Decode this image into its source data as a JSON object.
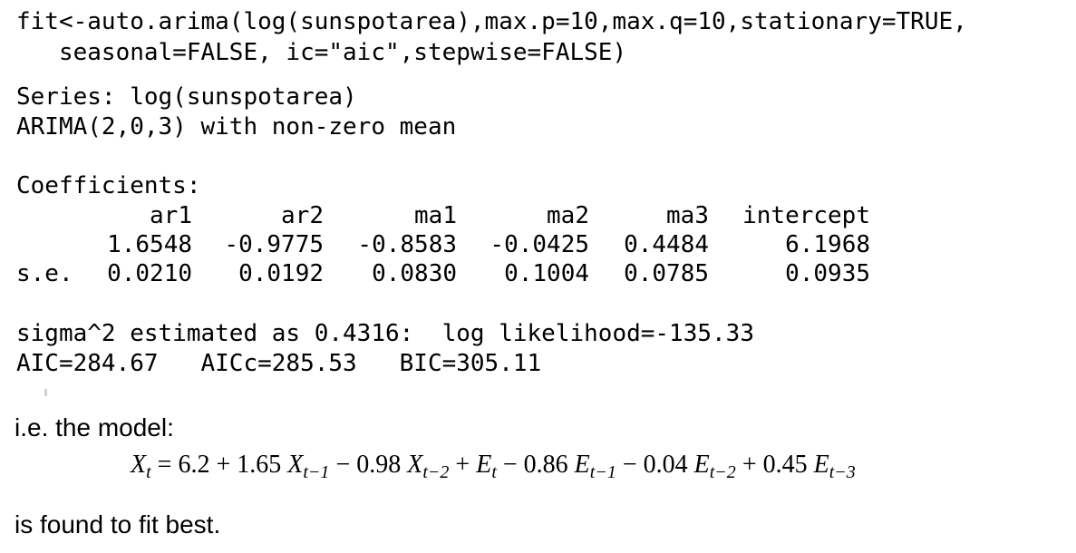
{
  "code": {
    "line1": "fit<-auto.arima(log(sunspotarea),max.p=10,max.q=10,stationary=TRUE,",
    "line2": "   seasonal=FALSE, ic=\"aic\",stepwise=FALSE)"
  },
  "output": {
    "series": "Series: log(sunspotarea)",
    "model": "ARIMA(2,0,3) with non-zero mean",
    "coef_heading": "Coefficients:",
    "se_label": "s.e.",
    "coefficients": [
      {
        "name": "ar1",
        "estimate": "1.6548",
        "se": "0.0210"
      },
      {
        "name": "ar2",
        "estimate": "-0.9775",
        "se": "0.0192"
      },
      {
        "name": "ma1",
        "estimate": "-0.8583",
        "se": "0.0830"
      },
      {
        "name": "ma2",
        "estimate": "-0.0425",
        "se": "0.1004"
      },
      {
        "name": "ma3",
        "estimate": "0.4484",
        "se": "0.0785"
      },
      {
        "name": "intercept",
        "estimate": "6.1968",
        "se": "0.0935"
      }
    ],
    "sigma_line": "sigma^2 estimated as 0.4316:  log likelihood=-135.33",
    "ic_line": "AIC=284.67   AICc=285.53   BIC=305.11"
  },
  "explanation": {
    "intro": "i.e. the model:",
    "conclusion": "is found to fit best."
  },
  "equation": {
    "lhs": "X",
    "lhs_sub": "t",
    "c0": "6.2",
    "c1": "1.65",
    "c2": "0.98",
    "c3": "0.86",
    "c4": "0.04",
    "c5": "0.45",
    "x1_sub": "t−1",
    "x2_sub": "t−2",
    "e0_sub": "t",
    "e1_sub": "t−1",
    "e2_sub": "t−2",
    "e3_sub": "t−3"
  }
}
